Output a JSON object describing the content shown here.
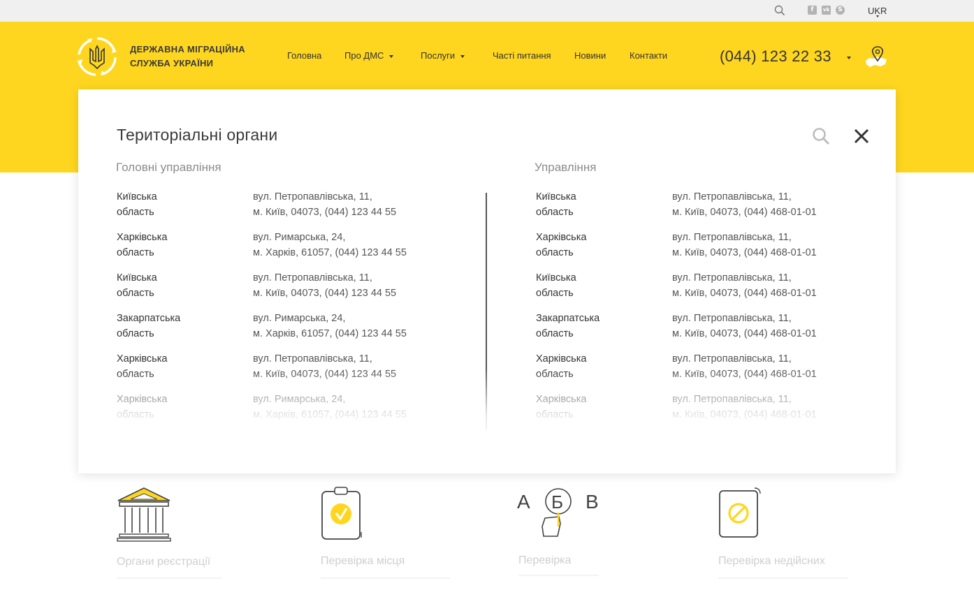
{
  "topbar": {
    "icons": [
      "search-icon",
      "facebook-icon",
      "vk-icon",
      "skype-icon"
    ],
    "social": {
      "facebook": "f",
      "vk": "vk",
      "skype": "S"
    },
    "language": "UKR"
  },
  "header": {
    "brand_line1": "ДЕРЖАВНА МІГРАЦІЙНА",
    "brand_line2": "СЛУЖБА УКРАЇНИ",
    "nav": [
      {
        "label": "Головна",
        "dropdown": false
      },
      {
        "label": "Про ДМС",
        "dropdown": true
      },
      {
        "label": "Послуги",
        "dropdown": true
      },
      {
        "label": "Часті питання",
        "dropdown": false
      },
      {
        "label": "Новини",
        "dropdown": false
      },
      {
        "label": "Контакти",
        "dropdown": false
      }
    ],
    "phone": "(044) 123 22 33"
  },
  "modal": {
    "title": "Територіальні органи",
    "left": {
      "heading": "Головні управління",
      "rows": [
        {
          "region1": "Київська",
          "region2": "область",
          "addr1": "вул. Петропавлівська, 11,",
          "addr2": "м. Київ, 04073, (044) 123 44 55"
        },
        {
          "region1": "Харківська",
          "region2": "область",
          "addr1": "вул. Римарська, 24,",
          "addr2": "м. Харків, 61057, (044) 123 44 55"
        },
        {
          "region1": "Київська",
          "region2": "область",
          "addr1": "вул. Петропавлівська, 11,",
          "addr2": "м. Київ, 04073, (044) 123 44 55"
        },
        {
          "region1": "Закарпатська",
          "region2": "область",
          "addr1": "вул. Римарська, 24,",
          "addr2": "м. Харків, 61057, (044) 123 44 55"
        },
        {
          "region1": "Харківська",
          "region2": "область",
          "addr1": "вул. Петропавлівська, 11,",
          "addr2": "м. Київ, 04073, (044) 123 44 55"
        },
        {
          "region1": "Харківська",
          "region2": "область",
          "addr1": "вул. Римарська, 24,",
          "addr2": "м. Харків, 61057, (044) 123 44 55"
        }
      ]
    },
    "right": {
      "heading": "Управління",
      "rows": [
        {
          "region1": "Київська",
          "region2": "область",
          "addr1": "вул. Петропавлівська, 11,",
          "addr2": "м. Київ, 04073, (044) 468-01-01"
        },
        {
          "region1": "Харківська",
          "region2": "область",
          "addr1": "вул. Петропавлівська, 11,",
          "addr2": "м. Київ, 04073, (044) 468-01-01"
        },
        {
          "region1": "Київська",
          "region2": "область",
          "addr1": "вул. Петропавлівська, 11,",
          "addr2": "м. Київ, 04073, (044) 468-01-01"
        },
        {
          "region1": "Закарпатська",
          "region2": "область",
          "addr1": "вул. Петропавлівська, 11,",
          "addr2": "м. Київ, 04073, (044) 468-01-01"
        },
        {
          "region1": "Харківська",
          "region2": "область",
          "addr1": "вул. Петропавлівська, 11,",
          "addr2": "м. Київ, 04073, (044) 468-01-01"
        },
        {
          "region1": "Харківська",
          "region2": "область",
          "addr1": "вул. Петропавлівська, 11,",
          "addr2": "м. Київ, 04073, (044) 468-01-01"
        }
      ]
    }
  },
  "services": [
    {
      "label": "Органи реєстрації",
      "icon": "government-building-icon"
    },
    {
      "label": "Перевірка місця",
      "icon": "clipboard-check-icon"
    },
    {
      "label": "Перевірка",
      "icon": "alphabet-hand-icon",
      "glyphs": [
        "А",
        "Б",
        "В"
      ]
    },
    {
      "label": "Перевірка недійсних",
      "icon": "invalid-document-icon"
    }
  ],
  "colors": {
    "accent": "#ffd61f",
    "text": "#333333",
    "muted": "#8c8c8c"
  }
}
